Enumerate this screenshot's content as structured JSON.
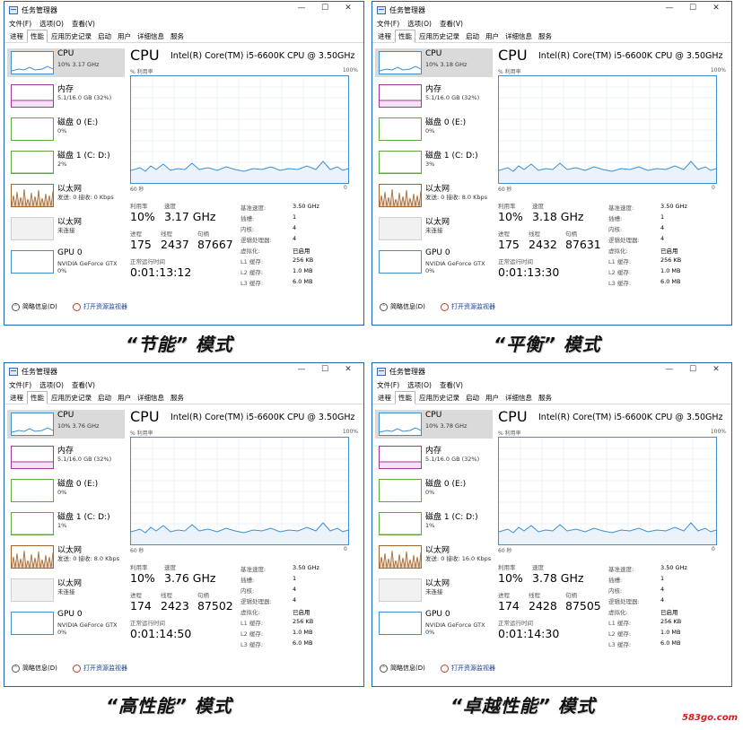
{
  "window": {
    "title": "任务管理器",
    "controls": [
      "—",
      "☐",
      "✕"
    ],
    "menus": [
      "文件(F)",
      "选项(O)",
      "查看(V)"
    ],
    "tabs": [
      "进程",
      "性能",
      "应用历史记录",
      "启动",
      "用户",
      "详细信息",
      "服务"
    ],
    "active_tab": 1
  },
  "sidebar": {
    "cpu_name": "CPU",
    "memory_name": "内存",
    "memory_sub": "5.1/16.0 GB (32%)",
    "disk0_name": "磁盘 0 (E:)",
    "disk0_sub": "0%",
    "disk1_name": "磁盘 1 (C: D:)",
    "eth1_name": "以太网",
    "eth2_name": "以太网",
    "eth2_sub": "未连接",
    "gpu_name": "GPU 0",
    "gpu_sub1": "NVIDIA GeForce GTX",
    "gpu_sub2": "0%"
  },
  "main": {
    "title": "CPU",
    "model": "Intel(R) Core(TM) i5-6600K CPU @ 3.50GHz",
    "graph_label": "% 利用率",
    "graph_max": "100%",
    "graph_time": "60 秒",
    "graph_min": "0",
    "util_label": "利用率",
    "speed_label": "速度",
    "proc_label": "进程",
    "thread_label": "线程",
    "handle_label": "句柄",
    "uptime_label": "正常运行时间",
    "specs": [
      {
        "k": "基准速度:",
        "v": "3.50 GHz"
      },
      {
        "k": "插槽:",
        "v": "1"
      },
      {
        "k": "内核:",
        "v": "4"
      },
      {
        "k": "逻辑处理器:",
        "v": "4"
      },
      {
        "k": "虚拟化:",
        "v": "已启用"
      },
      {
        "k": "L1 缓存:",
        "v": "256 KB"
      },
      {
        "k": "L2 缓存:",
        "v": "1.0 MB"
      },
      {
        "k": "L3 缓存:",
        "v": "6.0 MB"
      }
    ]
  },
  "footer": {
    "brief": "简略信息(D)",
    "monitor": "打开资源监视器"
  },
  "colors": {
    "cpu": "#3d8fd1",
    "memory": "#a0389a",
    "disk": "#5fa83b",
    "ethernet": "#a0642e",
    "gpu": "#3d8fd1"
  },
  "watermark": "583go.com",
  "panels": [
    {
      "cpu_sub": "10% 3.17 GHz",
      "disk1_sub": "2%",
      "eth1_sub": "发送: 0 接收: 0 Kbps",
      "utilization": "10%",
      "speed": "3.17 GHz",
      "processes": "175",
      "threads": "2437",
      "handles": "87667",
      "uptime": "0:01:13:12",
      "caption": "“节能” 模式"
    },
    {
      "cpu_sub": "10% 3.18 GHz",
      "disk1_sub": "3%",
      "eth1_sub": "发送: 0 接收: 8.0 Kbps",
      "utilization": "10%",
      "speed": "3.18 GHz",
      "processes": "175",
      "threads": "2432",
      "handles": "87631",
      "uptime": "0:01:13:30",
      "caption": "“平衡” 模式"
    },
    {
      "cpu_sub": "10% 3.76 GHz",
      "disk1_sub": "1%",
      "eth1_sub": "发送: 0 接收: 8.0 Kbps",
      "utilization": "10%",
      "speed": "3.76 GHz",
      "processes": "174",
      "threads": "2423",
      "handles": "87502",
      "uptime": "0:01:14:50",
      "caption": "“高性能” 模式"
    },
    {
      "cpu_sub": "10% 3.78 GHz",
      "disk1_sub": "1%",
      "eth1_sub": "发送: 0 接收: 16.0 Kbps",
      "utilization": "10%",
      "speed": "3.78 GHz",
      "processes": "174",
      "threads": "2428",
      "handles": "87505",
      "uptime": "0:01:14:30",
      "caption": "“卓越性能” 模式"
    }
  ]
}
